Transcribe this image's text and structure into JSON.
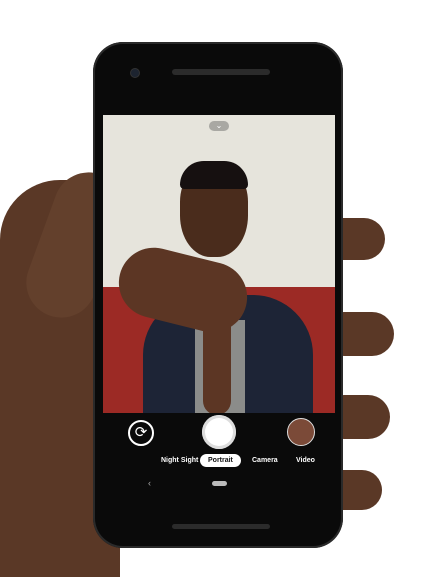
{
  "camera": {
    "modes": [
      {
        "label": "Night Sight",
        "selected": false
      },
      {
        "label": "Portrait",
        "selected": true
      },
      {
        "label": "Camera",
        "selected": false
      },
      {
        "label": "Video",
        "selected": false
      }
    ],
    "icons": {
      "switch": "camera-switch-icon",
      "pull": "chevron-down-icon",
      "back": "back-icon"
    },
    "pull_glyph": "⌄",
    "switch_glyph": "⟳",
    "back_glyph": "‹"
  }
}
